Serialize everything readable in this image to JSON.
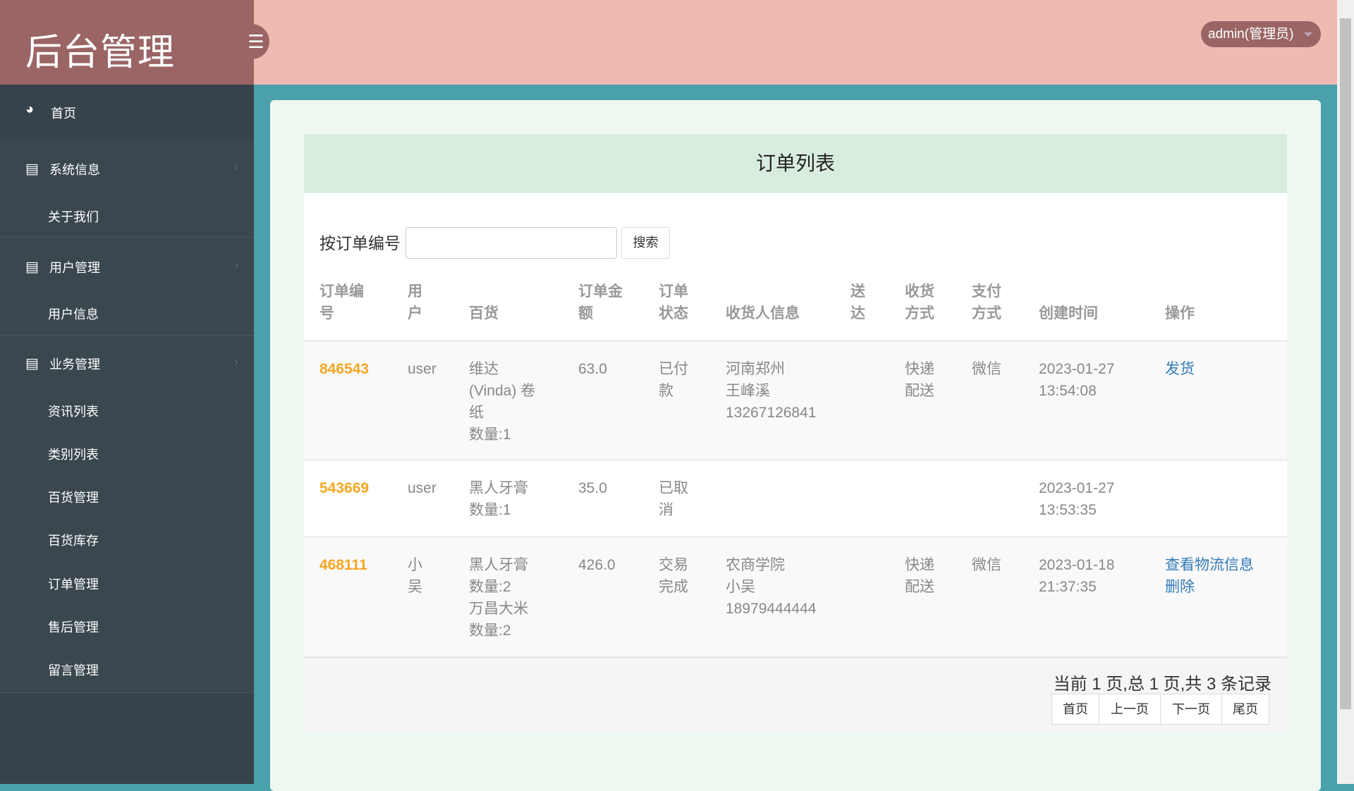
{
  "app": {
    "title": "后台管理",
    "user_label": "admin(管理员)"
  },
  "sidebar": {
    "home": "首页",
    "sections": [
      {
        "label": "系统信息",
        "items": [
          "关于我们"
        ]
      },
      {
        "label": "用户管理",
        "items": [
          "用户信息"
        ]
      },
      {
        "label": "业务管理",
        "items": [
          "资讯列表",
          "类别列表",
          "百货管理",
          "百货库存",
          "订单管理",
          "售后管理",
          "留言管理"
        ]
      }
    ]
  },
  "main": {
    "title": "订单列表",
    "search_label": "按订单编号",
    "search_value": "",
    "search_button": "搜索",
    "columns": [
      "订单编\n号",
      "用\n户",
      "百货",
      "订单金\n额",
      "订单\n状态",
      "收货人信息",
      "送\n达",
      "收货\n方式",
      "支付\n方式",
      "创建时间",
      "操作"
    ],
    "rows": [
      {
        "id": "846543",
        "user": "user",
        "goods": "维达\n(Vinda) 卷\n纸\n数量:1",
        "amount": "63.0",
        "status": "已付\n款",
        "receiver": "河南郑州\n王峰溪\n13267126841",
        "delivered": "",
        "ship": "快递\n配送",
        "pay": "微信",
        "time": "2023-01-27\n13:54:08",
        "actions": [
          "发货"
        ]
      },
      {
        "id": "543669",
        "user": "user",
        "goods": "黑人牙膏\n数量:1",
        "amount": "35.0",
        "status": "已取\n消",
        "receiver": "",
        "delivered": "",
        "ship": "",
        "pay": "",
        "time": "2023-01-27\n13:53:35",
        "actions": []
      },
      {
        "id": "468111",
        "user": "小\n吴",
        "goods": "黑人牙膏\n数量:2\n万昌大米\n数量:2",
        "amount": "426.0",
        "status": "交易\n完成",
        "receiver": "农商学院\n小吴\n18979444444",
        "delivered": "",
        "ship": "快递\n配送",
        "pay": "微信",
        "time": "2023-01-18\n21:37:35",
        "actions": [
          "查看物流信息",
          "删除"
        ]
      }
    ],
    "pagination": {
      "info": "当前 1 页,总 1 页,共 3 条记录",
      "first": "首页",
      "prev": "上一页",
      "next": "下一页",
      "last": "尾页"
    }
  }
}
